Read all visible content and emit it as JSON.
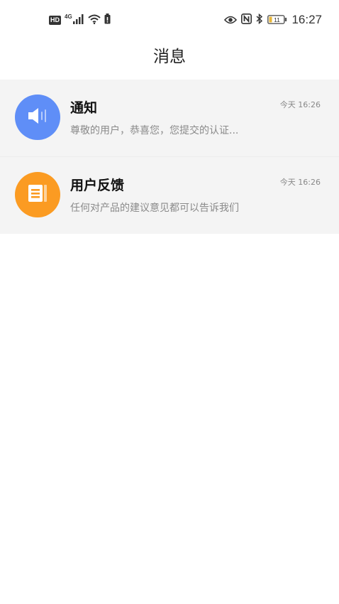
{
  "status_bar": {
    "hd_label": "HD",
    "network_type": "4G",
    "time": "16:27",
    "battery_level": "11",
    "icons": [
      "hd-icon",
      "signal-icon",
      "wifi-icon",
      "battery-saver-icon",
      "eye-icon",
      "nfc-icon",
      "bluetooth-icon",
      "battery-icon"
    ]
  },
  "header": {
    "title": "消息"
  },
  "messages": [
    {
      "title": "通知",
      "preview": "尊敬的用户，恭喜您，您提交的认证...",
      "time": "今天 16:26",
      "icon": "speaker-icon",
      "color": "#5f8ef7"
    },
    {
      "title": "用户反馈",
      "preview": "任何对产品的建议意见都可以告诉我们",
      "time": "今天 16:26",
      "icon": "feedback-icon",
      "color": "#fb9b22"
    }
  ]
}
